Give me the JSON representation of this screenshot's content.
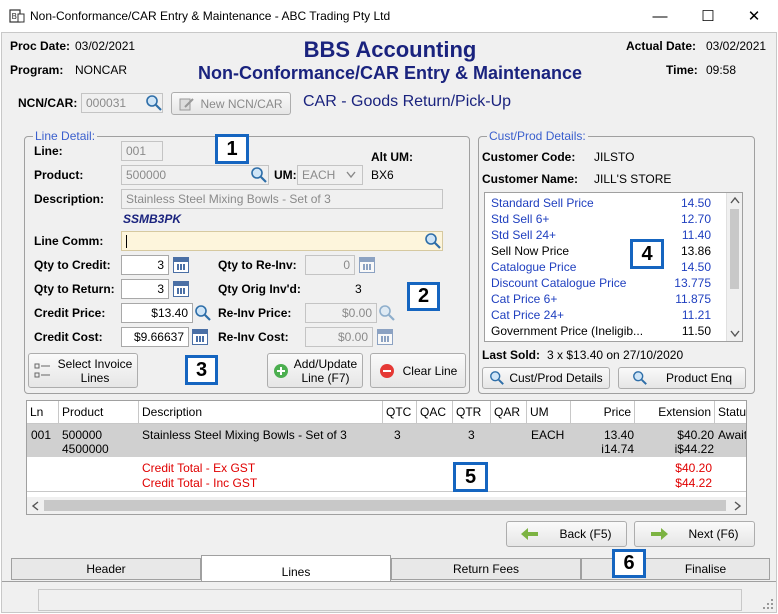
{
  "window": {
    "title": "Non-Conformance/CAR Entry & Maintenance - ABC Trading Pty Ltd",
    "minimize": "—",
    "maximize": "☐",
    "close": "✕"
  },
  "header": {
    "proc_date_label": "Proc Date:",
    "proc_date": "03/02/2021",
    "program_label": "Program:",
    "program": "NONCAR",
    "app_title": "BBS Accounting",
    "screen_title": "Non-Conformance/CAR Entry & Maintenance",
    "actual_date_label": "Actual Date:",
    "actual_date": "03/02/2021",
    "time_label": "Time:",
    "time": "09:58"
  },
  "ncn": {
    "label": "NCN/CAR:",
    "value": "000031",
    "new_button": "New NCN/CAR",
    "car_type": "CAR - Goods Return/Pick-Up"
  },
  "line_detail": {
    "group_label": "Line Detail:",
    "line_label": "Line:",
    "line": "001",
    "product_label": "Product:",
    "product": "500000",
    "um_label": "UM:",
    "um": "EACH",
    "alt_um_label": "Alt UM:",
    "alt_um": "BX6",
    "description_label": "Description:",
    "description": "Stainless Steel Mixing Bowls - Set of 3",
    "product_code": "SSMB3PK",
    "line_comm_label": "Line Comm:",
    "line_comm": "",
    "qty_credit_label": "Qty to Credit:",
    "qty_credit": "3",
    "qty_reinv_label": "Qty to Re-Inv:",
    "qty_reinv": "0",
    "qty_return_label": "Qty to Return:",
    "qty_return": "3",
    "qty_orig_label": "Qty Orig Inv'd:",
    "qty_orig": "3",
    "credit_price_label": "Credit Price:",
    "credit_price": "$13.40",
    "reinv_price_label": "Re-Inv Price:",
    "reinv_price": "$0.00",
    "credit_cost_label": "Credit Cost:",
    "credit_cost": "$9.66637",
    "reinv_cost_label": "Re-Inv Cost:",
    "reinv_cost": "$0.00",
    "select_invoice_button": [
      "Select Invoice",
      "Lines"
    ],
    "add_update_button": [
      "Add/Update",
      "Line (F7)"
    ],
    "clear_line_button": "Clear Line"
  },
  "cust_prod": {
    "group_label": "Cust/Prod Details:",
    "customer_code_label": "Customer Code:",
    "customer_code": "JILSTO",
    "customer_name_label": "Customer Name:",
    "customer_name": "JILL'S STORE",
    "prices": [
      {
        "name": "Standard Sell Price",
        "value": "14.50",
        "color": "#1f3fbf"
      },
      {
        "name": "Std Sell 6+",
        "value": "12.70",
        "color": "#1f3fbf"
      },
      {
        "name": "Std Sell 24+",
        "value": "11.40",
        "color": "#1f3fbf"
      },
      {
        "name": "Sell Now Price",
        "value": "13.86",
        "color": "#000000"
      },
      {
        "name": "Catalogue Price",
        "value": "14.50",
        "color": "#1f3fbf"
      },
      {
        "name": "Discount Catalogue Price",
        "value": "13.775",
        "color": "#1f3fbf"
      },
      {
        "name": "Cat Price 6+",
        "value": "11.875",
        "color": "#1f3fbf"
      },
      {
        "name": "Cat Price 24+",
        "value": "11.21",
        "color": "#1f3fbf"
      },
      {
        "name": "Government Price (Ineligib...",
        "value": "11.50",
        "color": "#000000"
      }
    ],
    "last_sold_label": "Last Sold:",
    "last_sold": "3 x $13.40 on 27/10/2020",
    "cust_prod_details_button": "Cust/Prod Details",
    "product_enq_button": "Product Enq"
  },
  "grid": {
    "columns": [
      "Ln",
      "Product",
      "Description",
      "QTC",
      "QAC",
      "QTR",
      "QAR",
      "UM",
      "Price",
      "Extension",
      "Status"
    ],
    "row": {
      "ln": "001",
      "product": "500000",
      "product2": "4500000",
      "description": "Stainless Steel Mixing Bowls - Set of 3",
      "qtc": "3",
      "qtr": "3",
      "um": "EACH",
      "price": "13.40",
      "price2": "i14.74",
      "extension": "$40.20",
      "extension2": "i$44.22",
      "status": "Awaiting"
    },
    "total_ex_label": "Credit Total - Ex GST",
    "total_ex": "$40.20",
    "total_inc_label": "Credit Total - Inc GST",
    "total_inc": "$44.22"
  },
  "nav": {
    "back_button": "Back (F5)",
    "next_button": "Next (F6)"
  },
  "tabs": [
    "Header",
    "Lines",
    "Return Fees",
    "Finalise"
  ],
  "badges": [
    "1",
    "2",
    "3",
    "4",
    "5",
    "6"
  ],
  "colors": {
    "title_blue": "#1a237e",
    "link_blue": "#1f3fbf",
    "total_red": "#e00000",
    "badge_border": "#1565c0"
  }
}
